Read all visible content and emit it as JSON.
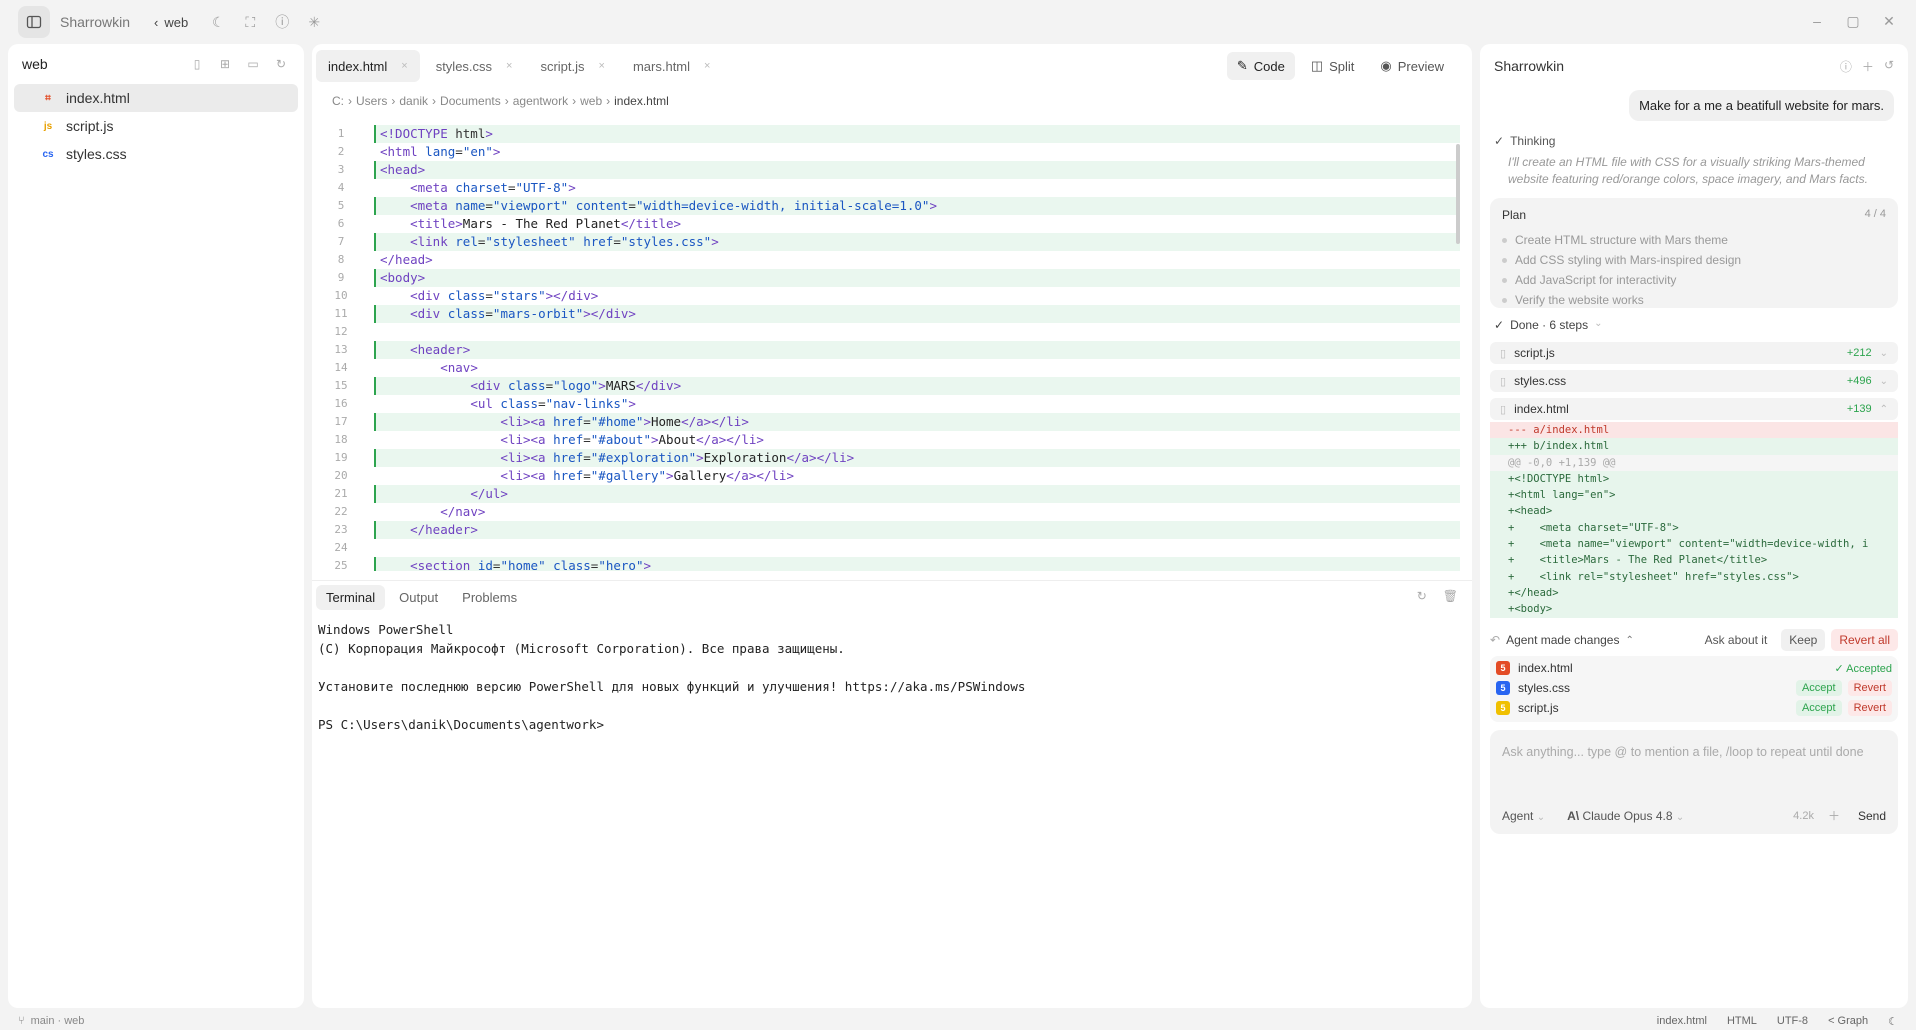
{
  "titlebar": {
    "app_name": "Sharrowkin",
    "crumb": "web",
    "icons": [
      "sidebar-toggle-icon",
      "moon-icon",
      "fullscreen-icon",
      "help-icon",
      "sparkle-icon"
    ],
    "window_controls": [
      "minimize-icon",
      "maximize-icon",
      "close-icon"
    ]
  },
  "explorer": {
    "title": "web",
    "files": [
      {
        "name": "index.html",
        "icon": "html-file-icon",
        "color": "#e34c26",
        "active": true
      },
      {
        "name": "script.js",
        "icon": "js-file-icon",
        "color": "#e8a000",
        "active": false
      },
      {
        "name": "styles.css",
        "icon": "css-file-icon",
        "color": "#2965f1",
        "active": false
      }
    ]
  },
  "editor": {
    "tabs": [
      {
        "label": "index.html",
        "active": true
      },
      {
        "label": "styles.css",
        "active": false
      },
      {
        "label": "script.js",
        "active": false
      },
      {
        "label": "mars.html",
        "active": false
      }
    ],
    "view_modes": [
      {
        "label": "Code",
        "active": true,
        "icon": "edit-icon"
      },
      {
        "label": "Split",
        "active": false,
        "icon": "split-icon"
      },
      {
        "label": "Preview",
        "active": false,
        "icon": "eye-icon"
      }
    ],
    "breadcrumb": [
      "C:",
      "Users",
      "danik",
      "Documents",
      "agentwork",
      "web",
      "index.html"
    ],
    "lines": [
      "<!DOCTYPE html>",
      "<html lang=\"en\">",
      "<head>",
      "    <meta charset=\"UTF-8\">",
      "    <meta name=\"viewport\" content=\"width=device-width, initial-scale=1.0\">",
      "    <title>Mars - The Red Planet</title>",
      "    <link rel=\"stylesheet\" href=\"styles.css\">",
      "</head>",
      "<body>",
      "    <div class=\"stars\"></div>",
      "    <div class=\"mars-orbit\"></div>",
      "",
      "    <header>",
      "        <nav>",
      "            <div class=\"logo\">MARS</div>",
      "            <ul class=\"nav-links\">",
      "                <li><a href=\"#home\">Home</a></li>",
      "                <li><a href=\"#about\">About</a></li>",
      "                <li><a href=\"#exploration\">Exploration</a></li>",
      "                <li><a href=\"#gallery\">Gallery</a></li>",
      "            </ul>",
      "        </nav>",
      "    </header>",
      "",
      "    <section id=\"home\" class=\"hero\">",
      "        <div class=\"hero-content\">"
    ],
    "added_lines": [
      1,
      3,
      5,
      7,
      9,
      11,
      13,
      15,
      17,
      19,
      21,
      23,
      25
    ]
  },
  "terminal": {
    "tabs": [
      {
        "label": "Terminal",
        "active": true
      },
      {
        "label": "Output",
        "active": false
      },
      {
        "label": "Problems",
        "active": false
      }
    ],
    "lines": [
      "Windows PowerShell",
      "(C) Корпорация Майкрософт (Microsoft Corporation). Все права защищены.",
      "",
      "Установите последнюю версию PowerShell для новых функций и улучшения! https://aka.ms/PSWindows",
      "",
      "PS C:\\Users\\danik\\Documents\\agentwork>"
    ]
  },
  "chat": {
    "title": "Sharrowkin",
    "user_message": "Make for a me a beatifull website for mars.",
    "thinking_label": "Thinking",
    "thinking_text": "I'll create an HTML file with CSS for a visually striking Mars-themed website featuring red/orange colors, space imagery, and Mars facts.",
    "plan": {
      "title": "Plan",
      "count": "4 / 4",
      "items": [
        "Create HTML structure with Mars theme",
        "Add CSS styling with Mars-inspired design",
        "Add JavaScript for interactivity",
        "Verify the website works"
      ]
    },
    "done_label": "Done · 6 steps",
    "files": [
      {
        "name": "script.js",
        "added": "+212"
      },
      {
        "name": "styles.css",
        "added": "+496"
      },
      {
        "name": "index.html",
        "added": "+139"
      }
    ],
    "diff": [
      {
        "type": "del",
        "text": "--- a/index.html"
      },
      {
        "type": "add",
        "text": "+++ b/index.html"
      },
      {
        "type": "meta",
        "text": "@@ -0,0 +1,139 @@"
      },
      {
        "type": "add",
        "text": "+<!DOCTYPE html>"
      },
      {
        "type": "add",
        "text": "+<html lang=\"en\">"
      },
      {
        "type": "add",
        "text": "+<head>"
      },
      {
        "type": "add",
        "text": "+    <meta charset=\"UTF-8\">"
      },
      {
        "type": "add",
        "text": "+    <meta name=\"viewport\" content=\"width=device-width, i"
      },
      {
        "type": "add",
        "text": "+    <title>Mars - The Red Planet</title>"
      },
      {
        "type": "add",
        "text": "+    <link rel=\"stylesheet\" href=\"styles.css\">"
      },
      {
        "type": "add",
        "text": "+</head>"
      },
      {
        "type": "add",
        "text": "+<body>"
      }
    ],
    "changes_bar": {
      "label": "Agent made changes",
      "ask": "Ask about it",
      "keep": "Keep",
      "revert_all": "Revert all"
    },
    "changes": [
      {
        "name": "index.html",
        "icon_color": "#e34c26",
        "status": "accepted",
        "accepted_label": "✓ Accepted"
      },
      {
        "name": "styles.css",
        "icon_color": "#2965f1",
        "status": "pending",
        "accept_label": "Accept",
        "revert_label": "Revert"
      },
      {
        "name": "script.js",
        "icon_color": "#f0c000",
        "status": "pending",
        "accept_label": "Accept",
        "revert_label": "Revert"
      }
    ],
    "composer": {
      "placeholder": "Ask anything... type @ to mention a file, /loop to repeat until done",
      "mode": "Agent",
      "model": "Claude Opus 4.8",
      "tokens": "4.2k",
      "send": "Send"
    }
  },
  "statusbar": {
    "branch": "main · web",
    "file": "index.html",
    "language": "HTML",
    "encoding": "UTF-8",
    "graph": "Graph"
  }
}
